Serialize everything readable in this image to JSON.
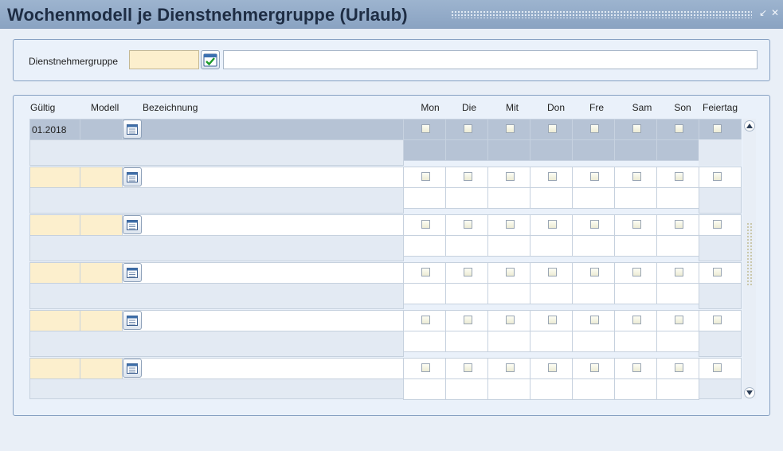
{
  "window": {
    "title": "Wochenmodell je Dienstnehmergruppe (Urlaub)"
  },
  "filter": {
    "group_label": "Dienstnehmergruppe",
    "group_code": "",
    "group_name": ""
  },
  "table": {
    "columns": {
      "valid": "Gültig",
      "model": "Modell",
      "description": "Bezeichnung",
      "mon": "Mon",
      "tue": "Die",
      "wed": "Mit",
      "thu": "Don",
      "fri": "Fre",
      "sat": "Sam",
      "sun": "Son",
      "holiday": "Feiertag"
    },
    "rows": [
      {
        "valid": "01.2018",
        "model": "",
        "description": "",
        "days": [
          false,
          false,
          false,
          false,
          false,
          false,
          false,
          false
        ]
      },
      {
        "valid": "",
        "model": "",
        "description": "",
        "days": [
          false,
          false,
          false,
          false,
          false,
          false,
          false,
          false
        ]
      },
      {
        "valid": "",
        "model": "",
        "description": "",
        "days": [
          false,
          false,
          false,
          false,
          false,
          false,
          false,
          false
        ]
      },
      {
        "valid": "",
        "model": "",
        "description": "",
        "days": [
          false,
          false,
          false,
          false,
          false,
          false,
          false,
          false
        ]
      },
      {
        "valid": "",
        "model": "",
        "description": "",
        "days": [
          false,
          false,
          false,
          false,
          false,
          false,
          false,
          false
        ]
      },
      {
        "valid": "",
        "model": "",
        "description": "",
        "days": [
          false,
          false,
          false,
          false,
          false,
          false,
          false,
          false
        ]
      }
    ]
  },
  "icons": {
    "title_minimize": "minimize-icon",
    "title_close": "close-icon",
    "group_lookup": "checklist-icon",
    "row_calendar": "calendar-icon",
    "scroll_up": "arrow-up-icon",
    "scroll_down": "arrow-down-icon"
  },
  "colors": {
    "title_bar": "#8ea7c5",
    "required_field": "#fcefcd",
    "selected_row": "#b6c3d5",
    "panel_border": "#86a0c2"
  }
}
